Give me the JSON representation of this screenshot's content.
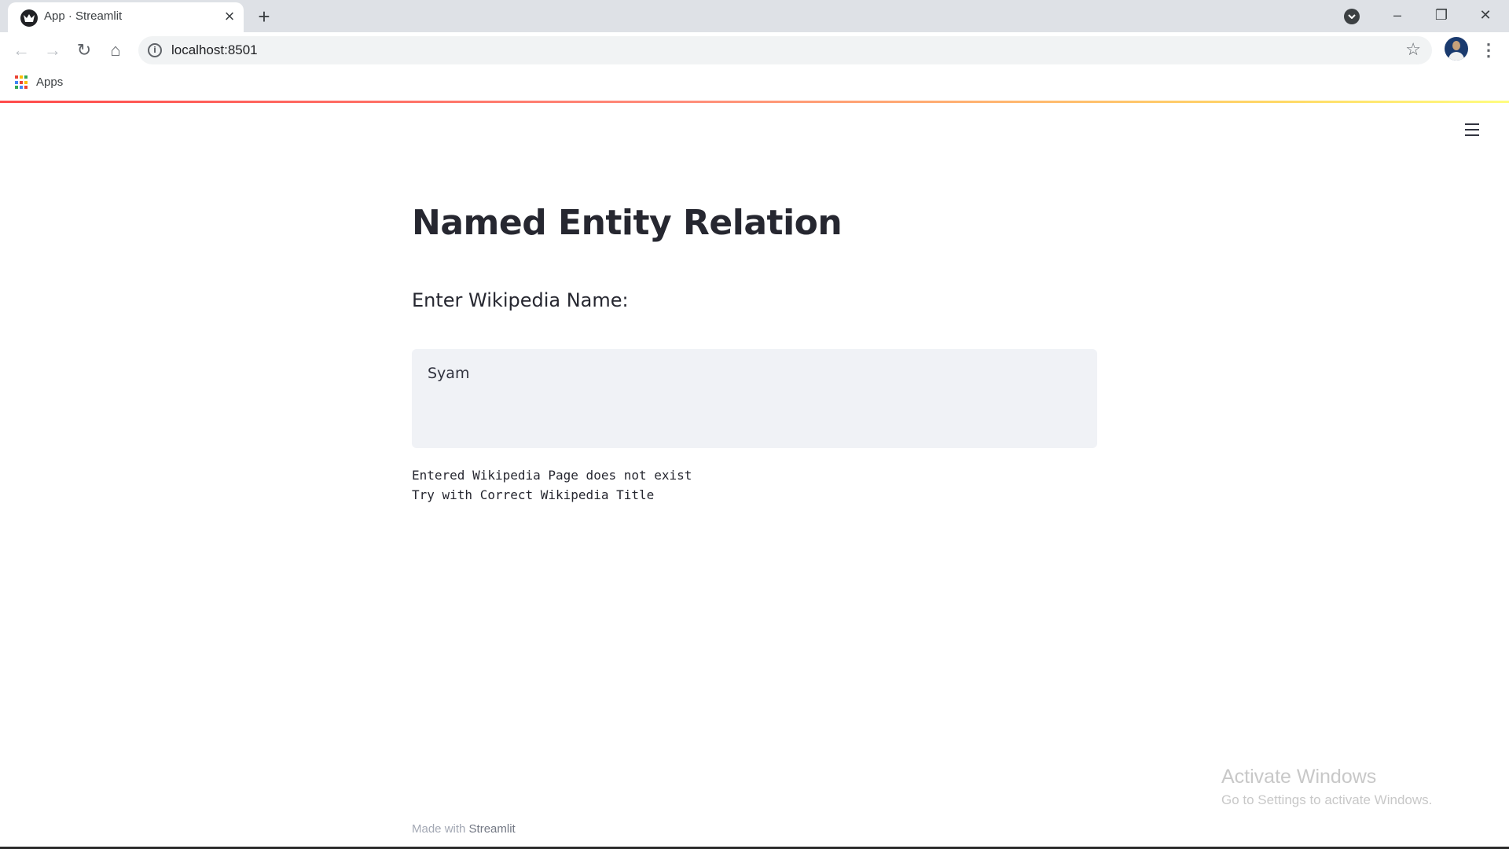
{
  "browser": {
    "tab": {
      "title": "App · Streamlit",
      "close_icon": "×",
      "favicon": "streamlit-crown-icon"
    },
    "new_tab_icon": "+",
    "window_controls": {
      "minimize": "–",
      "restore": "❐",
      "close": "✕"
    },
    "toolbar": {
      "back_icon": "←",
      "forward_icon": "→",
      "reload_icon": "↻",
      "home_icon": "⌂",
      "info_icon": "i",
      "url": "localhost:8501",
      "bookmark_icon": "☆",
      "menu_icon": "⋮"
    },
    "bookmarks": {
      "apps_label": "Apps"
    }
  },
  "app": {
    "title": "Named Entity Relation",
    "input_label": "Enter Wikipedia Name:",
    "input_value": "Syam",
    "message": "Entered Wikipedia Page does not exist\nTry with Correct Wikipedia Title",
    "footer": {
      "prefix": "Made with ",
      "brand": "Streamlit"
    }
  },
  "watermark": {
    "title": "Activate Windows",
    "subtitle": "Go to Settings to activate Windows."
  },
  "colors": {
    "accent": "#ff4b4b",
    "text": "#262730",
    "input_bg": "#f0f2f6",
    "tabstrip_bg": "#dee1e6"
  }
}
